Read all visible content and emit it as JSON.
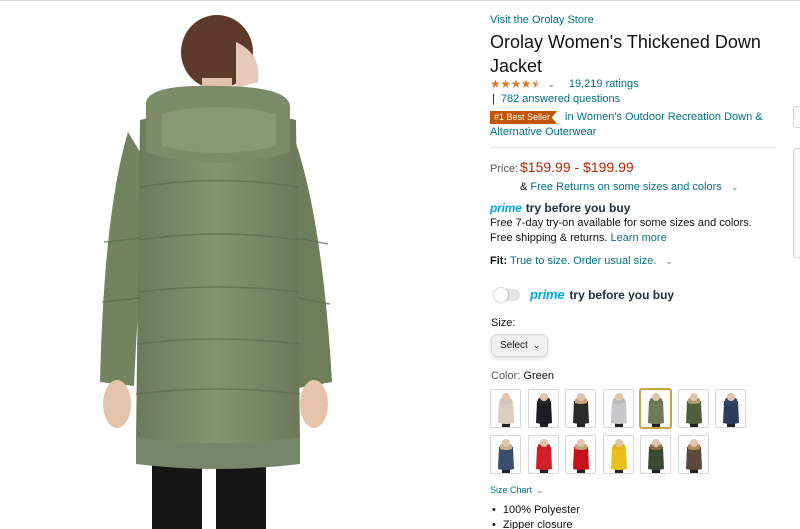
{
  "store": {
    "link": "Visit the Orolay Store"
  },
  "product": {
    "title": "Orolay Women's Thickened Down Jacket"
  },
  "rating": {
    "stars": 4.5,
    "count_text": "19,219 ratings",
    "answered": "782 answered questions"
  },
  "bestseller": {
    "badge": "#1 Best Seller",
    "category": "in Women's Outdoor Recreation Down & Alternative Outerwear"
  },
  "price": {
    "label": "Price:",
    "range": "$159.99 - $199.99"
  },
  "returns": {
    "prefix": "&",
    "link": "Free Returns on some sizes and colors"
  },
  "prime_try": {
    "prime": "prime",
    "text": "try before you buy",
    "line1": "Free 7-day try-on available for some sizes and colors.",
    "line2_text": "Free shipping & returns.",
    "line2_link": "Learn more"
  },
  "fit": {
    "label": "Fit:",
    "value": "True to size. Order usual size."
  },
  "toggle": {
    "prime": "prime",
    "text": "try before you buy",
    "on": false
  },
  "size": {
    "label": "Size:",
    "selected": "Select"
  },
  "color": {
    "label": "Color:",
    "selected": "Green",
    "swatches": [
      {
        "coat": "#d8cfc3",
        "hood": "#cfc5b8"
      },
      {
        "coat": "#1c1d22",
        "hood": "#2a2b30"
      },
      {
        "coat": "#2a2a2a",
        "hood": "#c9a57a"
      },
      {
        "coat": "#c6c8ca",
        "hood": "#b9bbbd"
      },
      {
        "coat": "#6f7b58",
        "hood": "#667250"
      },
      {
        "coat": "#4f5e3b",
        "hood": "#b59b6b"
      },
      {
        "coat": "#2c3d5c",
        "hood": "#34466a"
      },
      {
        "coat": "#3b4d6e",
        "hood": "#c7b08a"
      },
      {
        "coat": "#d41f2a",
        "hood": "#c81b25"
      },
      {
        "coat": "#c8101c",
        "hood": "#c9a57a"
      },
      {
        "coat": "#e8c11a",
        "hood": "#dfb716"
      },
      {
        "coat": "#3d4a33",
        "hood": "#8a6d4c"
      },
      {
        "coat": "#5b4a3c",
        "hood": "#b08b5c"
      }
    ]
  },
  "size_chart": {
    "label": "Size Chart"
  },
  "bullets": [
    "100% Polyester",
    "Zipper closure"
  ],
  "colors": {
    "link": "#007185",
    "price": "#b12704",
    "prime": "#00a8e1",
    "star": "#de7921",
    "badge": "#c45500",
    "jacket": "#7a8a68"
  }
}
